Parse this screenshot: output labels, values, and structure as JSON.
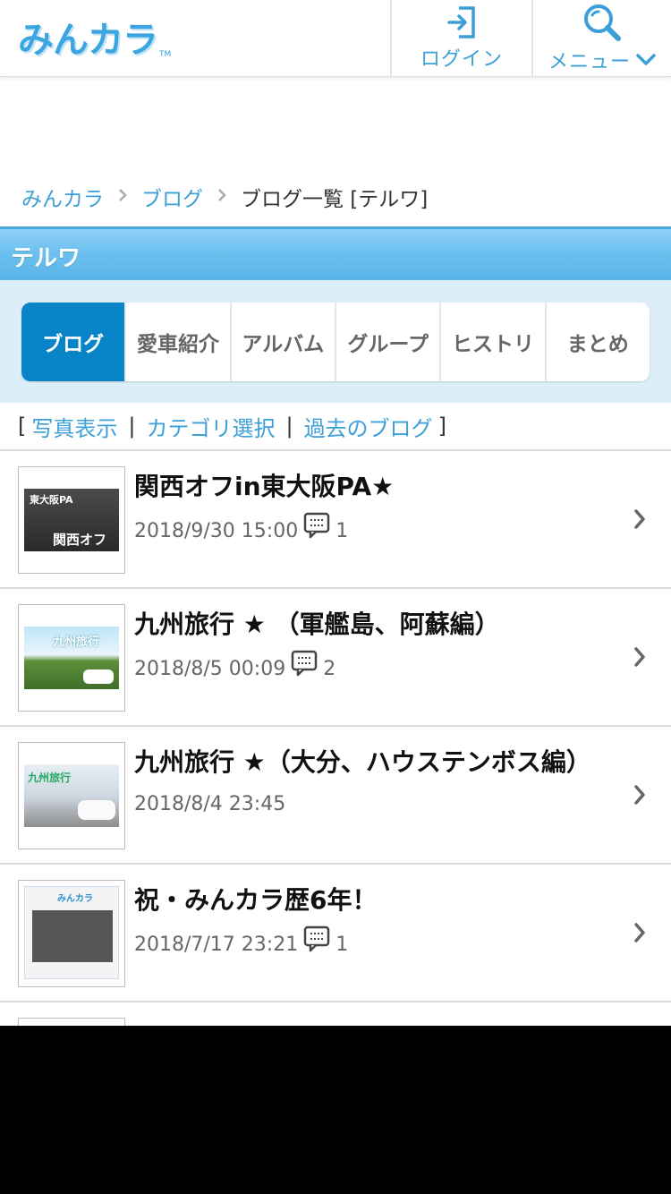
{
  "header": {
    "logo": "みんカラ",
    "logo_tm": "TM",
    "login_label": "ログイン",
    "menu_label": "メニュー"
  },
  "breadcrumb": {
    "items": [
      "みんカラ",
      "ブログ"
    ],
    "current": "ブログ一覧 [テルワ]"
  },
  "owner": {
    "name": "テルワ"
  },
  "tabs": [
    {
      "label": "ブログ",
      "active": true
    },
    {
      "label": "愛車紹介"
    },
    {
      "label": "アルバム"
    },
    {
      "label": "グループ"
    },
    {
      "label": "ヒストリ"
    },
    {
      "label": "まとめ"
    }
  ],
  "sublinks": {
    "open": "[",
    "photo": "写真表示",
    "sep1": "|",
    "category": "カテゴリ選択",
    "sep2": "|",
    "past": "過去のブログ",
    "close": "]"
  },
  "posts": [
    {
      "title": "関西オフin東大阪PA★",
      "date": "2018/9/30 15:00",
      "comments": "1",
      "thumb_text": "関西オフ"
    },
    {
      "title": "九州旅行 ★ （軍艦島、阿蘇編）",
      "date": "2018/8/5 00:09",
      "comments": "2",
      "thumb_text": "九州旅行"
    },
    {
      "title": "九州旅行 ★（大分、ハウステンボス編）",
      "date": "2018/8/4 23:45",
      "comments": "",
      "thumb_text": "九州旅行"
    },
    {
      "title": "祝・みんカラ歴6年！",
      "date": "2018/7/17 23:21",
      "comments": "1",
      "thumb_text": "みんカラ"
    }
  ],
  "colors": {
    "accent": "#3c9fd8",
    "tab_active": "#0a84c8",
    "owner_bar": "#6cc0ef"
  }
}
